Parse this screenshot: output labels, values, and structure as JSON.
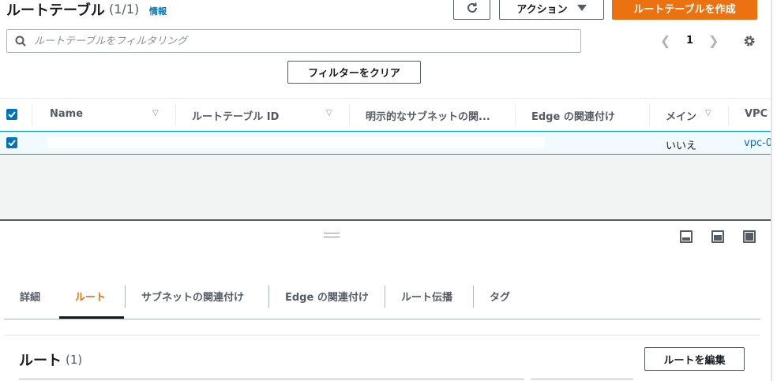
{
  "header": {
    "title": "ルートテーブル",
    "count": "(1/1)",
    "info_link": "情報",
    "action_label": "アクション",
    "create_label": "ルートテーブルを作成"
  },
  "search": {
    "placeholder": "ルートテーブルをフィルタリング"
  },
  "pagination": {
    "current_page": "1"
  },
  "filter": {
    "clear_label": "フィルターをクリア"
  },
  "table": {
    "columns": [
      "Name",
      "ルートテーブル ID",
      "明示的なサブネットの関...",
      "Edge の関連付け",
      "メイン",
      "VPC"
    ],
    "row": {
      "main": "いいえ",
      "vpc": "vpc-0"
    }
  },
  "detail_tabs": [
    "詳細",
    "ルート",
    "サブネットの関連付け",
    "Edge の関連付け",
    "ルート伝播",
    "タグ"
  ],
  "routes_panel": {
    "title": "ルート",
    "count": "(1)",
    "edit_label": "ルートを編集"
  },
  "colors": {
    "accent": "#ec7211",
    "link": "#0073bb",
    "selected_row_bg": "#f1faff"
  }
}
